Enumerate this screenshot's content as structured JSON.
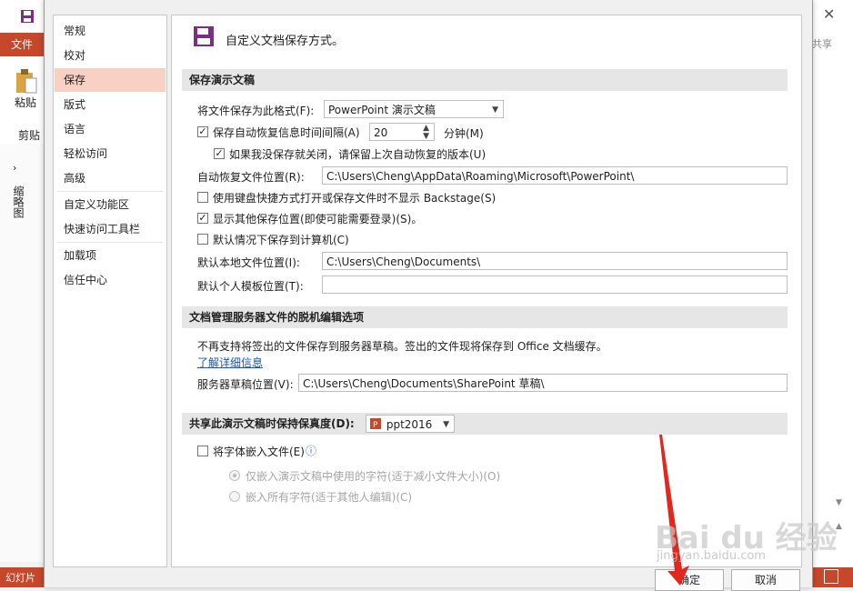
{
  "background": {
    "file_tab": "文件",
    "paste_label": "粘贴",
    "clipboard_label": "剪贴",
    "thumbnails_label": "缩略图",
    "share_label": "共享",
    "slides_status": "幻灯片",
    "close_glyph": "✕",
    "chevron": "›"
  },
  "nav": {
    "items": [
      "常规",
      "校对",
      "保存",
      "版式",
      "语言",
      "轻松访问",
      "高级",
      "自定义功能区",
      "快速访问工具栏",
      "加载项",
      "信任中心"
    ],
    "selected": "保存"
  },
  "header": {
    "title": "自定义文档保存方式。"
  },
  "section_save": {
    "title": "保存演示文稿",
    "format_label": "将文件保存为此格式(F):",
    "format_value": "PowerPoint 演示文稿",
    "autorecover_label": "保存自动恢复信息时间间隔(A)",
    "autorecover_checked": true,
    "autorecover_minutes": "20",
    "minutes_label": "分钟(M)",
    "keep_last_label": "如果我没保存就关闭，请保留上次自动恢复的版本(U)",
    "keep_last_checked": true,
    "autorecover_path_label": "自动恢复文件位置(R):",
    "autorecover_path": "C:\\Users\\Cheng\\AppData\\Roaming\\Microsoft\\PowerPoint\\",
    "no_backstage_label": "使用键盘快捷方式打开或保存文件时不显示 Backstage(S)",
    "no_backstage_checked": false,
    "show_other_label": "显示其他保存位置(即使可能需要登录)(S)。",
    "show_other_checked": true,
    "save_to_pc_label": "默认情况下保存到计算机(C)",
    "save_to_pc_checked": false,
    "local_path_label": "默认本地文件位置(I):",
    "local_path": "C:\\Users\\Cheng\\Documents\\",
    "template_path_label": "默认个人模板位置(T):",
    "template_path": ""
  },
  "section_offline": {
    "title": "文档管理服务器文件的脱机编辑选项",
    "note": "不再支持将签出的文件保存到服务器草稿。签出的文件现将保存到 Office 文档缓存。",
    "learn_more": "了解详细信息",
    "drafts_label": "服务器草稿位置(V):",
    "drafts_path": "C:\\Users\\Cheng\\Documents\\SharePoint 草稿\\"
  },
  "section_fidelity": {
    "title": "共享此演示文稿时保持保真度(D):",
    "file_name": "ppt2016",
    "embed_label": "将字体嵌入文件(E)",
    "embed_checked": false,
    "info_icon": "ⓘ",
    "option1": "仅嵌入演示文稿中使用的字符(适于减小文件大小)(O)",
    "option2": "嵌入所有字符(适于其他人编辑)(C)"
  },
  "buttons": {
    "ok": "确定",
    "cancel": "取消"
  },
  "watermark": {
    "main": "Bai du 经验",
    "sub": "jingyan.baidu.com"
  },
  "colors": {
    "accent": "#c7472b",
    "nav_selected": "#f8d1c4",
    "arrow": "#e0281e"
  }
}
